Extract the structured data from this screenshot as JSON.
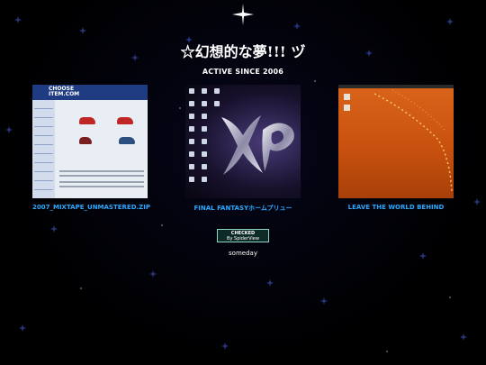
{
  "page": {
    "title": "☆幻想的な夢!!! ヅ",
    "subtitle": "ACTIVE SINCE 2006",
    "footer": "someday"
  },
  "gallery": [
    {
      "caption": "2007_MIXTAPE_UNMASTERED.ZIP",
      "preview": "used-car-website-screenshot"
    },
    {
      "caption": "FINAL FANTASYホームプリュー",
      "preview": "desktop-xp-logo-screenshot"
    },
    {
      "caption": "LEAVE THE WORLD BEHIND",
      "preview": "orange-desktop-screenshot"
    }
  ],
  "badge": {
    "line1": "CHECKED",
    "line2": "By SpiderView"
  },
  "thumb1": {
    "logo_top": "CHOOSE",
    "logo_bottom": "ITEM.COM"
  },
  "colors": {
    "link": "#2aa8ff",
    "background": "#000000"
  },
  "icons": {
    "top_star": "sparkle-star-icon"
  }
}
